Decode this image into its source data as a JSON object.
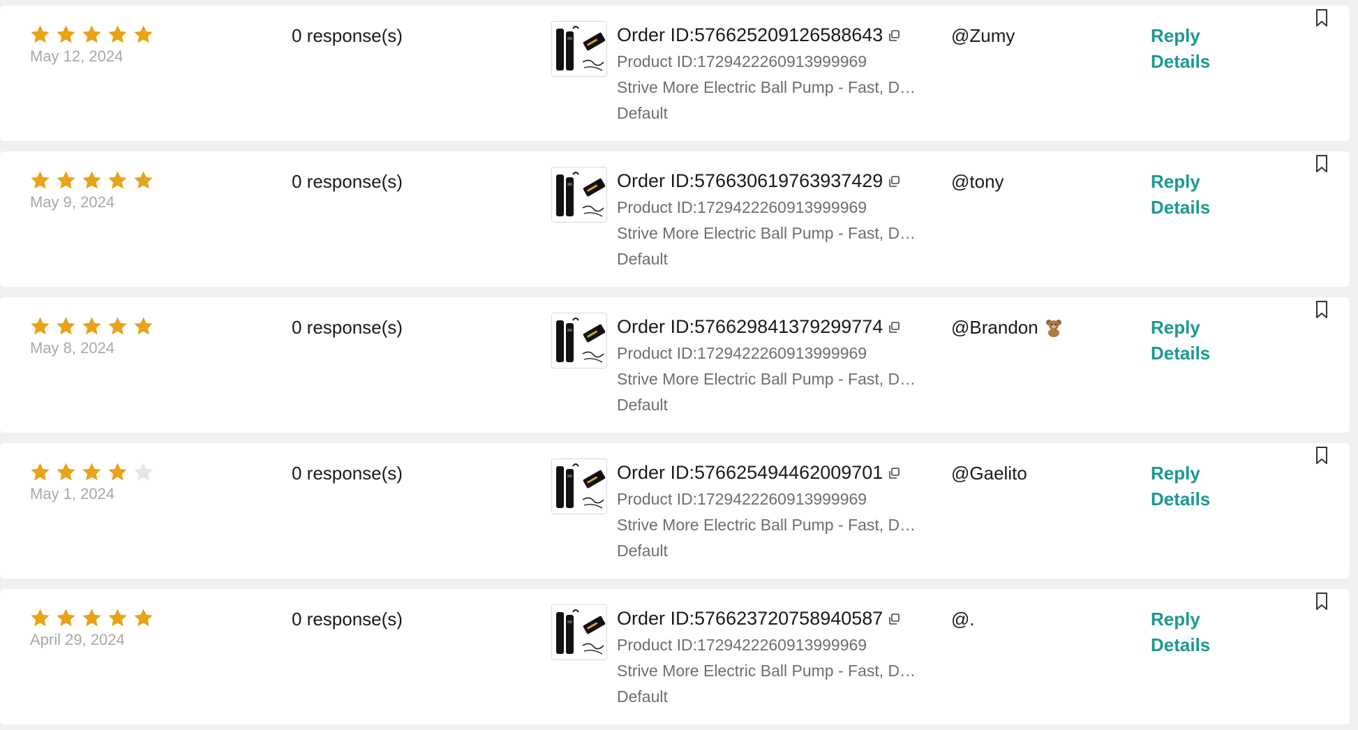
{
  "colors": {
    "star_on": "#e8a317",
    "star_off": "#e6e6e6",
    "link": "#1a9a8f"
  },
  "reviews": [
    {
      "rating": 5,
      "date": "May 12, 2024",
      "responses": "0 response(s)",
      "order_id": "Order ID:576625209126588643",
      "product_id": "Product ID:1729422260913999969",
      "product_name": "Strive More Electric Ball Pump - Fast, Du...",
      "variant": "Default",
      "user": "@Zumy",
      "reply_label": "Reply",
      "details_label": "Details"
    },
    {
      "rating": 5,
      "date": "May 9, 2024",
      "responses": "0 response(s)",
      "order_id": "Order ID:576630619763937429",
      "product_id": "Product ID:1729422260913999969",
      "product_name": "Strive More Electric Ball Pump - Fast, Du...",
      "variant": "Default",
      "user": "@tony",
      "reply_label": "Reply",
      "details_label": "Details"
    },
    {
      "rating": 5,
      "date": "May 8, 2024",
      "responses": "0 response(s)",
      "order_id": "Order ID:576629841379299774",
      "product_id": "Product ID:1729422260913999969",
      "product_name": "Strive More Electric Ball Pump - Fast, Du...",
      "variant": "Default",
      "user": "@Brandon",
      "user_icon": "teddy-bear-emoji",
      "reply_label": "Reply",
      "details_label": "Details"
    },
    {
      "rating": 4,
      "date": "May 1, 2024",
      "responses": "0 response(s)",
      "order_id": "Order ID:576625494462009701",
      "product_id": "Product ID:1729422260913999969",
      "product_name": "Strive More Electric Ball Pump - Fast, Du...",
      "variant": "Default",
      "user": "@Gaelito",
      "reply_label": "Reply",
      "details_label": "Details"
    },
    {
      "rating": 5,
      "date": "April 29, 2024",
      "responses": "0 response(s)",
      "order_id": "Order ID:576623720758940587",
      "product_id": "Product ID:1729422260913999969",
      "product_name": "Strive More Electric Ball Pump - Fast, Du...",
      "variant": "Default",
      "user": "@.",
      "reply_label": "Reply",
      "details_label": "Details"
    }
  ]
}
